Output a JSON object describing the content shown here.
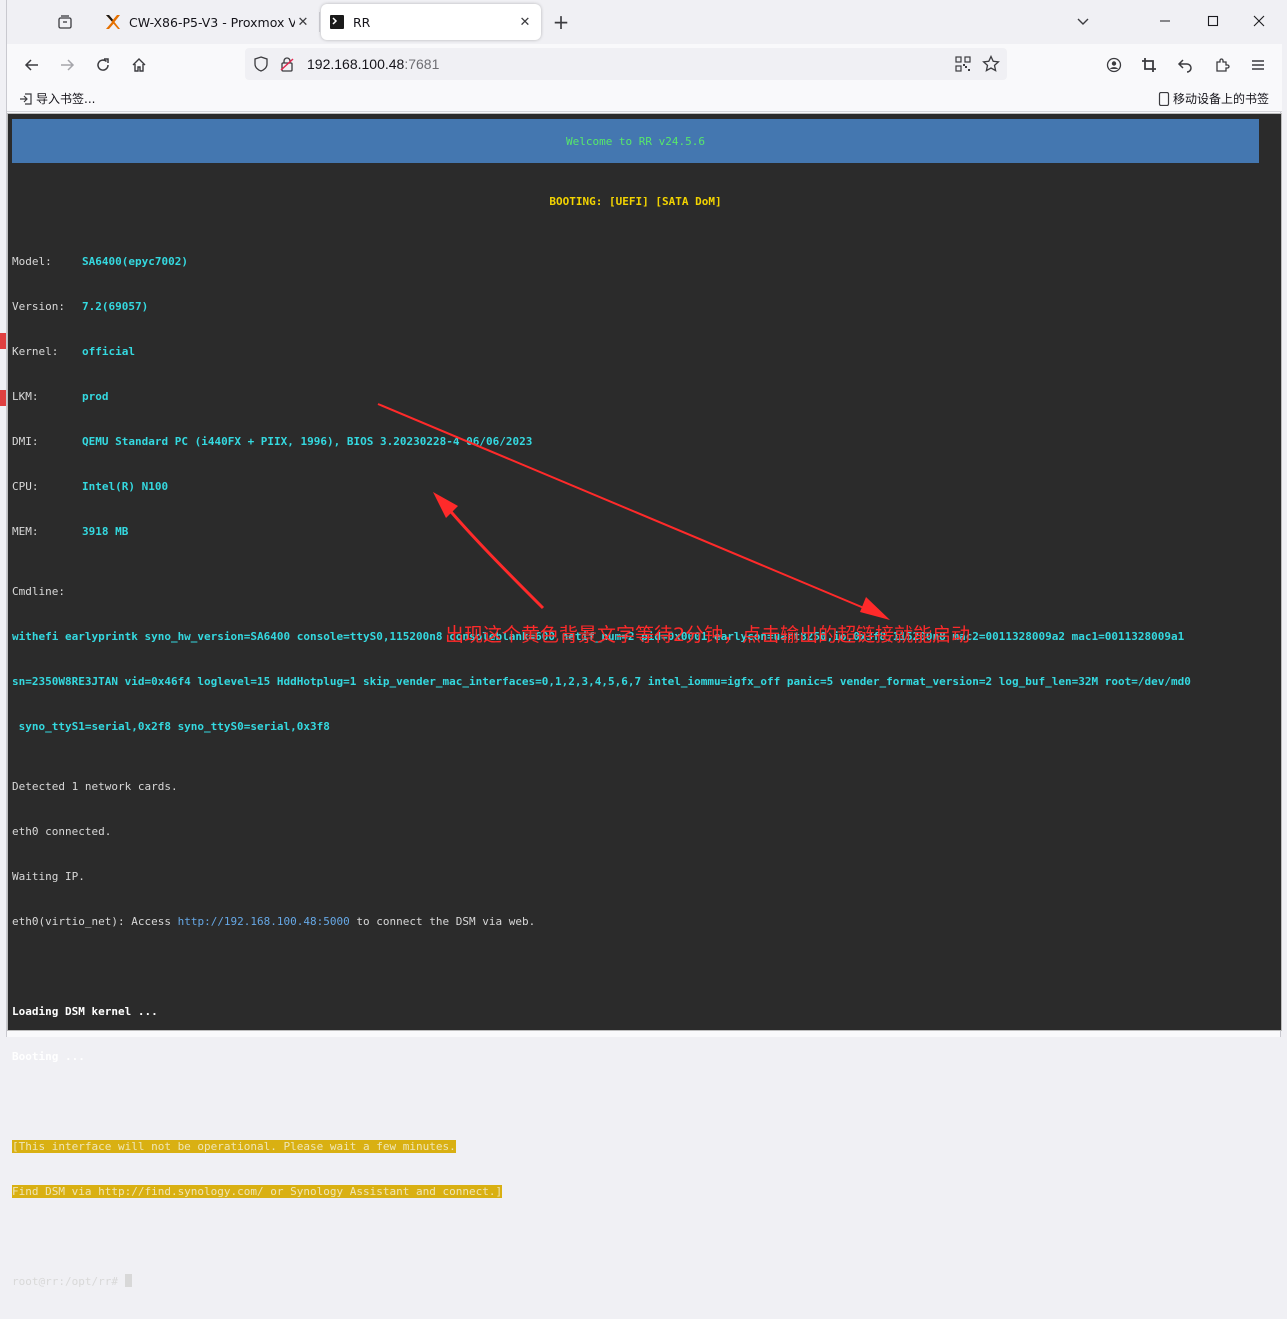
{
  "tabs": [
    {
      "title": "CW-X86-P5-V3 - Proxmox Vi",
      "icon": "proxmox-logo-icon",
      "active": false
    },
    {
      "title": "RR",
      "icon": "terminal-icon",
      "active": true
    }
  ],
  "address_bar": {
    "host": "192.168.100.48",
    "port": ":7681"
  },
  "bookmarks": {
    "import_label": "导入书签...",
    "mobile_label": "移动设备上的书签"
  },
  "terminal": {
    "banner": "Welcome to RR v24.5.6",
    "boot_line": "BOOTING: [UEFI] [SATA DoM]",
    "info": [
      {
        "key": "Model:",
        "value": "SA6400(epyc7002)"
      },
      {
        "key": "Version:",
        "value": "7.2(69057)"
      },
      {
        "key": "Kernel:",
        "value": "official"
      },
      {
        "key": "LKM:",
        "value": "prod"
      },
      {
        "key": "DMI:",
        "value": "QEMU Standard PC (i440FX + PIIX, 1996), BIOS 3.20230228-4 06/06/2023"
      },
      {
        "key": "CPU:",
        "value": "Intel(R) N100"
      },
      {
        "key": "MEM:",
        "value": "3918 MB"
      }
    ],
    "cmdline_label": "Cmdline:",
    "cmdline": [
      "withefi earlyprintk syno_hw_version=SA6400 console=ttyS0,115200n8 consoleblank=600 netif_num=2 pid=0x0001 earlycon=uart8250,io,0x3f8,115200n8 mac2=0011328009a2 mac1=0011328009a1",
      "sn=2350W8RE3JTAN vid=0x46f4 loglevel=15 HddHotplug=1 skip_vender_mac_interfaces=0,1,2,3,4,5,6,7 intel_iommu=igfx_off panic=5 vender_format_version=2 log_buf_len=32M root=/dev/md0",
      " syno_ttyS1=serial,0x2f8 syno_ttyS0=serial,0x3f8"
    ],
    "status_lines": [
      "Detected 1 network cards.",
      "eth0 connected.",
      "Waiting IP."
    ],
    "access": {
      "prefix": "eth0(virtio_net): Access ",
      "url": "http://192.168.100.48:5000",
      "suffix": " to connect the DSM via web."
    },
    "loading": "Loading DSM kernel ...",
    "booting": "Booting ...",
    "notice_1": "[This interface will not be operational. Please wait a few minutes.",
    "notice_2": "Find DSM via http://find.synology.com/ or Synology Assistant and connect.]",
    "prompt": "root@rr:/opt/rr# "
  },
  "annotation": "出现这个黄色背景文字等待2分钟，点击输出的超链接就能启动",
  "colors": {
    "banner_bg": "#4477b0",
    "banner_text": "#57e86b",
    "boot_text": "#f3d400",
    "value_text": "#34d9e0",
    "highlight_bg": "#d9b012",
    "annotation": "#ff2a2a",
    "terminal_bg": "#2b2b2b"
  }
}
